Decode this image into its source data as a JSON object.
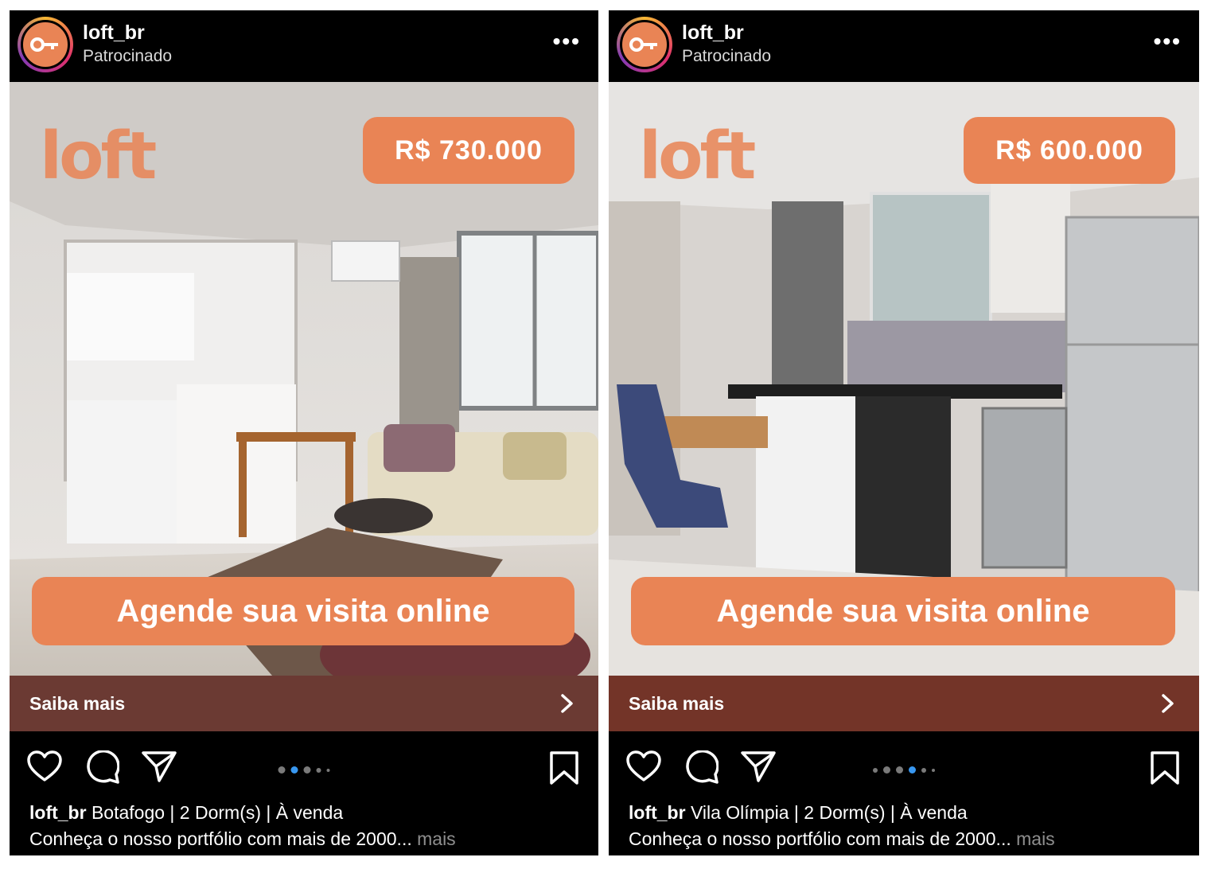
{
  "posts": [
    {
      "account": "loft_br",
      "sponsored_label": "Patrocinado",
      "logo_text": "loft",
      "price": "R$ 730.000",
      "cta": "Agende sua visita online",
      "saiba_mais": "Saiba mais",
      "carousel": {
        "count": 5,
        "active_index": 1
      },
      "caption_user": "loft_br",
      "caption_text": "Botafogo | 2 Dorm(s) | À venda",
      "caption_line2": "Conheça o nosso portfólio com mais de 2000...",
      "caption_more": "mais"
    },
    {
      "account": "loft_br",
      "sponsored_label": "Patrocinado",
      "logo_text": "loft",
      "price": "R$ 600.000",
      "cta": "Agende sua visita online",
      "saiba_mais": "Saiba mais",
      "carousel": {
        "count": 6,
        "active_index": 3
      },
      "caption_user": "loft_br",
      "caption_text": "Vila Olímpia | 2 Dorm(s) | À venda",
      "caption_line2": "Conheça o nosso portfólio com mais de 2000...",
      "caption_more": "mais"
    }
  ],
  "colors": {
    "brand_orange": "#e98455",
    "saiba_bar": "#6b3a33",
    "active_dot": "#3897f0"
  },
  "icons": [
    "key-icon",
    "more-options-icon",
    "chevron-right-icon",
    "heart-icon",
    "comment-icon",
    "share-icon",
    "bookmark-icon"
  ]
}
